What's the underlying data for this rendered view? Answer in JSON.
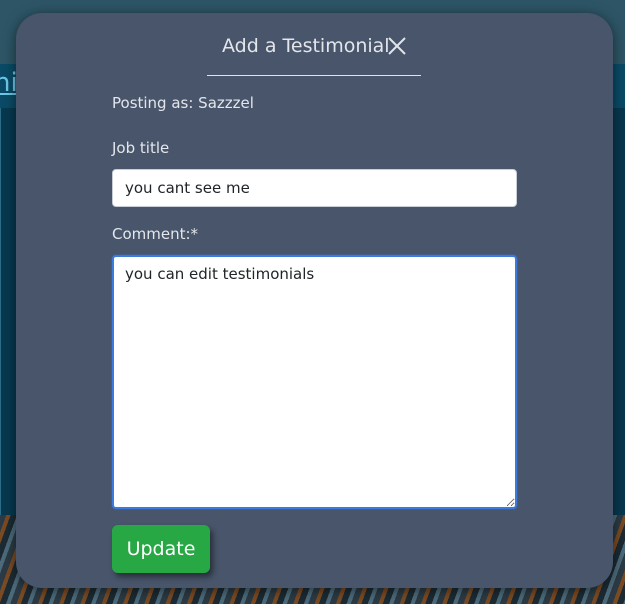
{
  "background": {
    "band_text": "ni"
  },
  "modal": {
    "title": "Add a Testimonial",
    "close_icon": "close-icon",
    "posting_as": "Posting as: Sazzzel"
  },
  "form": {
    "job_title_label": "Job title",
    "job_title_value": "you cant see me",
    "comment_label": "Comment:*",
    "comment_value": "you can edit testimonials",
    "submit_label": "Update"
  },
  "colors": {
    "modal_bg": "#48556a",
    "accent_button": "#28a745",
    "focus_border": "#3b7be0"
  }
}
